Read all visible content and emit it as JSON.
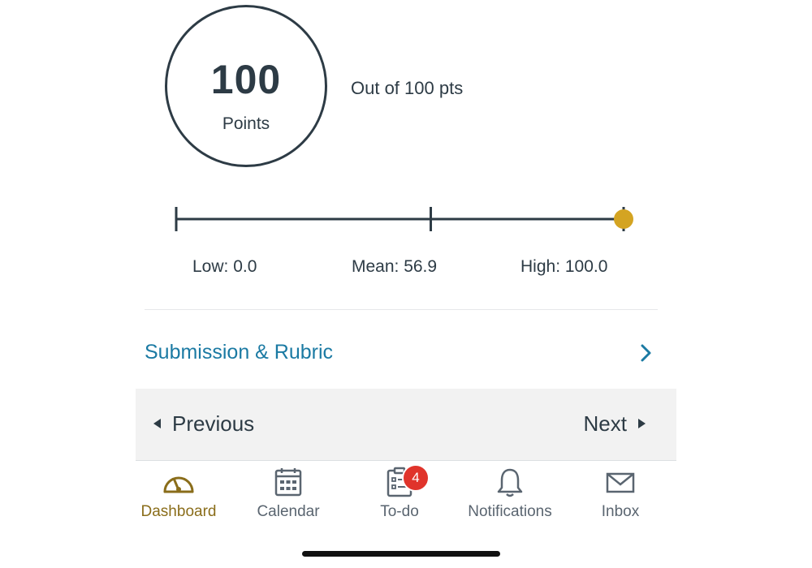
{
  "score": {
    "value": "100",
    "unit": "Points",
    "out_of": "Out of 100 pts"
  },
  "stats": {
    "low_label": "Low: 0.0",
    "mean_label": "Mean: 56.9",
    "high_label": "High: 100.0",
    "low": 0.0,
    "mean": 56.9,
    "high": 100.0,
    "your_score": 100,
    "marker_color": "#d4a422"
  },
  "submission": {
    "label": "Submission & Rubric"
  },
  "pager": {
    "previous": "Previous",
    "next": "Next"
  },
  "tabs": [
    {
      "label": "Dashboard",
      "icon": "dashboard-icon",
      "active": true
    },
    {
      "label": "Calendar",
      "icon": "calendar-icon",
      "active": false
    },
    {
      "label": "To-do",
      "icon": "todo-icon",
      "active": false,
      "badge": "4"
    },
    {
      "label": "Notifications",
      "icon": "bell-icon",
      "active": false
    },
    {
      "label": "Inbox",
      "icon": "inbox-icon",
      "active": false
    }
  ],
  "colors": {
    "text": "#2d3b45",
    "link": "#1b7aa3",
    "active_tab": "#8a6d1a",
    "badge": "#e0342b"
  }
}
